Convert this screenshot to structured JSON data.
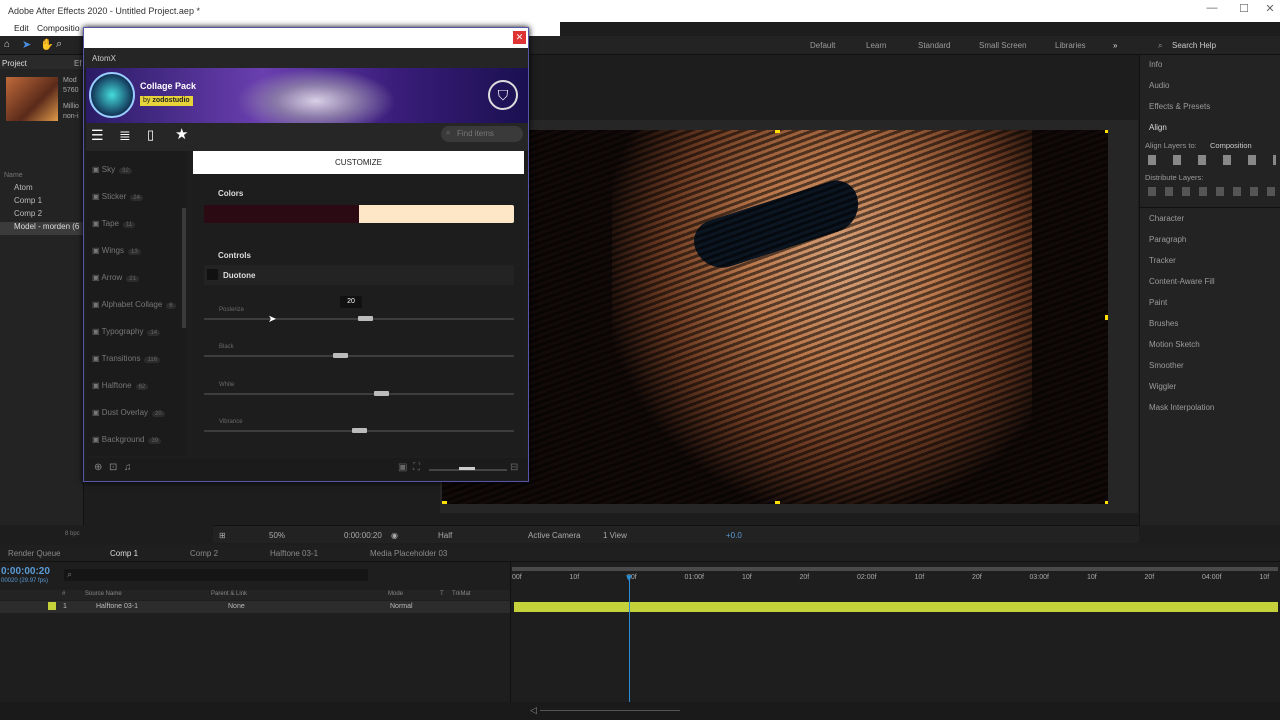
{
  "window": {
    "title": "Adobe After Effects 2020 - Untitled Project.aep *"
  },
  "menu": {
    "edit": "Edit",
    "composition": "Compositio"
  },
  "workspaces": [
    "Default",
    "Learn",
    "Standard",
    "Small Screen",
    "Libraries"
  ],
  "search_help": "Search Help",
  "project": {
    "tab": "Project",
    "tab2": "Ef",
    "item_name": "Mod",
    "item_res": "5760",
    "item_info": "Millio",
    "item_info2": "non-i",
    "col_name": "Name",
    "items": [
      "Atom",
      "Comp 1",
      "Comp 2",
      "Model - morden (6"
    ]
  },
  "atomx": {
    "title": "AtomX",
    "pack_name": "Collage Pack",
    "pack_by": "by",
    "pack_author": "zodostudio",
    "search_placeholder": "Find items",
    "customize": "CUSTOMIZE",
    "colors_label": "Colors",
    "color_dark": "#2b0a14",
    "color_light": "#fde7c6",
    "controls_label": "Controls",
    "effect_name": "Duotone",
    "categories": [
      {
        "label": "Sky",
        "count": "32"
      },
      {
        "label": "Sticker",
        "count": "24"
      },
      {
        "label": "Tape",
        "count": "11"
      },
      {
        "label": "Wings",
        "count": "13"
      },
      {
        "label": "Arrow",
        "count": "21"
      },
      {
        "label": "Alphabet Collage",
        "count": "6"
      },
      {
        "label": "Typography",
        "count": "14"
      },
      {
        "label": "Transitions",
        "count": "116"
      },
      {
        "label": "Halftone",
        "count": "62"
      },
      {
        "label": "Dust Overlay",
        "count": "20"
      },
      {
        "label": "Background",
        "count": "39"
      }
    ],
    "sliders": [
      {
        "label": "Posterize",
        "value": 0.52,
        "tooltip": "20"
      },
      {
        "label": "Black",
        "value": 0.44
      },
      {
        "label": "White",
        "value": 0.57
      },
      {
        "label": "Vibrance",
        "value": 0.5
      }
    ]
  },
  "right_panel": {
    "items": [
      "Info",
      "Audio",
      "Effects & Presets"
    ],
    "align": "Align",
    "align_to_label": "Align Layers to:",
    "align_to_value": "Composition",
    "distribute": "Distribute Layers:",
    "more": [
      "Character",
      "Paragraph",
      "Tracker",
      "Content-Aware Fill",
      "Paint",
      "Brushes",
      "Motion Sketch",
      "Smoother",
      "Wiggler",
      "Mask Interpolation"
    ]
  },
  "comp_bar": {
    "zoom": "50%",
    "time": "0:00:00:20",
    "res": "Half",
    "camera": "Active Camera",
    "views": "1 View",
    "exposure": "+0.0",
    "bpc": "8 bpc"
  },
  "tabs": [
    "Render Queue",
    "Comp 1",
    "Comp 2",
    "Halftone 03-1",
    "Media Placeholder 03"
  ],
  "timeline": {
    "timecode": "0:00:00:20",
    "fps": "00020 (29.97 fps)",
    "cols": {
      "num": "#",
      "source": "Source Name",
      "parent": "Parent & Link",
      "mode": "Mode",
      "t": "T",
      "trkmat": "TrkMat"
    },
    "layer": {
      "num": "1",
      "name": "Halftone 03-1",
      "parent": "None",
      "mode": "Normal"
    },
    "ruler": [
      "00f",
      "10f",
      "20f",
      "01:00f",
      "10f",
      "20f",
      "02:00f",
      "10f",
      "20f",
      "03:00f",
      "10f",
      "20f",
      "04:00f",
      "10f"
    ]
  },
  "colors": {
    "track": "#c5d13a",
    "playhead": "#2b8fd6",
    "accent": "#5b9bd5"
  }
}
